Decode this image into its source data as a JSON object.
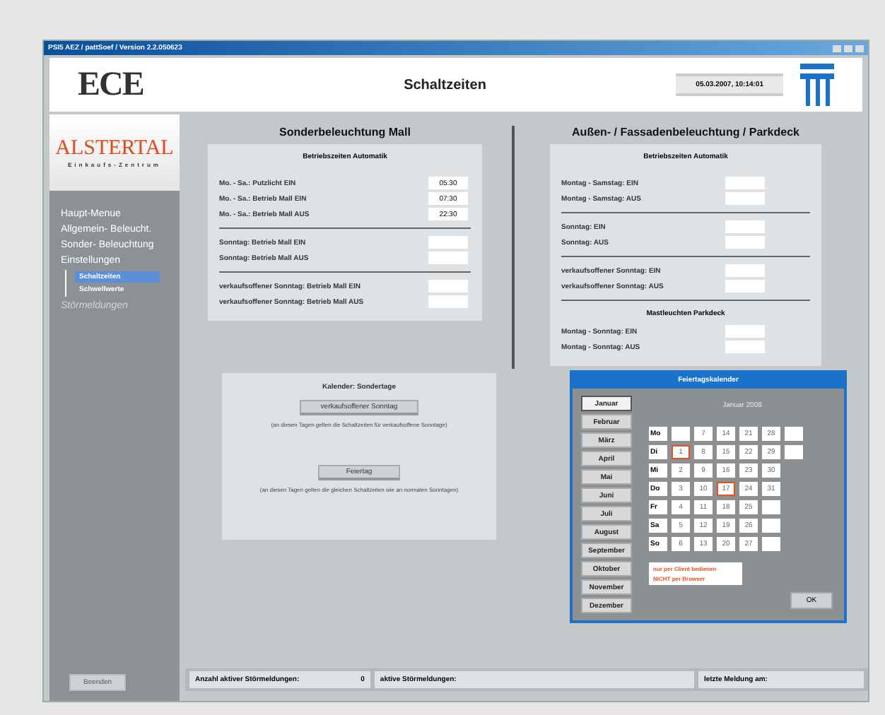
{
  "window": {
    "title": "PSI5 AEZ / pattSoef / Version 2.2.050623"
  },
  "header": {
    "logo": "ECE",
    "title": "Schaltzeiten",
    "datetime": "05.03.2007, 10:14:01"
  },
  "sidebar": {
    "logo": {
      "name": "ALSTERTAL",
      "tagline": "Einkaufs-Zentrum"
    },
    "items": [
      {
        "label": "Haupt-Menue",
        "disabled": false
      },
      {
        "label": "Allgemein- Beleucht.",
        "disabled": false
      },
      {
        "label": "Sonder- Beleuchtung",
        "disabled": false
      },
      {
        "label": "Einstellungen",
        "disabled": false,
        "children": [
          {
            "label": "Schaltzeiten",
            "selected": true
          },
          {
            "label": "Schwellwerte",
            "selected": false
          }
        ]
      },
      {
        "label": "Störmeldungen",
        "disabled": true
      }
    ],
    "exit_button": "Beenden"
  },
  "mall": {
    "title": "Sonderbeleuchtung Mall",
    "subtitle": "Betriebszeiten Automatik",
    "groups": [
      [
        {
          "label": "Mo. - Sa.: Putzlicht  EIN",
          "value": "05:30"
        },
        {
          "label": "Mo. - Sa.: Betrieb Mall  EIN",
          "value": "07:30"
        },
        {
          "label": "Mo. - Sa.: Betrieb Mall AUS",
          "value": "22:30"
        }
      ],
      [
        {
          "label": "Sonntag:  Betrieb Mall EIN"
        },
        {
          "label": "Sonntag:  Betrieb Mall AUS"
        }
      ],
      [
        {
          "label": "verkaufsoffener Sonntag:  Betrieb Mall EIN"
        },
        {
          "label": "verkaufsoffener Sonntag:  Betrieb Mall AUS"
        }
      ]
    ]
  },
  "outdoor": {
    "title": "Außen- / Fassadenbeleuchtung / Parkdeck",
    "subtitle": "Betriebszeiten Automatik",
    "groups": [
      [
        {
          "label": "Montag - Samstag:  EIN"
        },
        {
          "label": "Montag - Samstag:  AUS"
        }
      ],
      [
        {
          "label": "Sonntag:  EIN"
        },
        {
          "label": "Sonntag:  AUS"
        }
      ],
      [
        {
          "label": "verkaufsoffener Sonntag:  EIN"
        },
        {
          "label": "verkaufsoffener Sonntag:   AUS"
        }
      ]
    ],
    "parking_title": "Mastleuchten Parkdeck",
    "parking": [
      {
        "label": "Montag - Sonntag:  EIN"
      },
      {
        "label": "Montag - Sonntag:  AUS"
      }
    ]
  },
  "special_days": {
    "title": "Kalender: Sondertage",
    "items": [
      {
        "button": "verkaufsoffener Sonntag",
        "note": "(an diesen Tagen gelten die Schaltzeiten für verkaufsoffene Sonntage)"
      },
      {
        "button": "Feiertag",
        "note": "(an diesen Tagen gelten die gleichen Schaltzeiten wie an normalen Sonntagen)"
      }
    ]
  },
  "holiday_calendar": {
    "title": "Feiertagskalender",
    "months": [
      {
        "label": "Januar",
        "selected": true
      },
      {
        "label": "Februar",
        "selected": false
      },
      {
        "label": "März",
        "selected": false
      },
      {
        "label": "April",
        "selected": false
      },
      {
        "label": "Mai",
        "selected": false
      },
      {
        "label": "Juni",
        "selected": false
      },
      {
        "label": "Juli",
        "selected": false
      },
      {
        "label": "August",
        "selected": false
      },
      {
        "label": "September",
        "selected": false
      },
      {
        "label": "Oktober",
        "selected": false
      },
      {
        "label": "November",
        "selected": false
      },
      {
        "label": "Dezember",
        "selected": false
      }
    ],
    "month_title": "Januar 2008",
    "rows": [
      {
        "day": "Mo",
        "cells": [
          {
            "kind": "empty"
          },
          {
            "kind": "day",
            "text": "7",
            "selected": false
          },
          {
            "kind": "day",
            "text": "14",
            "selected": false
          },
          {
            "kind": "day",
            "text": "21",
            "selected": false
          },
          {
            "kind": "day",
            "text": "28",
            "selected": false
          },
          {
            "kind": "empty"
          }
        ]
      },
      {
        "day": "Di",
        "cells": [
          {
            "kind": "day",
            "text": "1",
            "selected": true
          },
          {
            "kind": "day",
            "text": "8",
            "selected": false
          },
          {
            "kind": "day",
            "text": "15",
            "selected": false
          },
          {
            "kind": "day",
            "text": "22",
            "selected": false
          },
          {
            "kind": "day",
            "text": "29",
            "selected": false
          },
          {
            "kind": "empty"
          }
        ]
      },
      {
        "day": "Mi",
        "cells": [
          {
            "kind": "day",
            "text": "2",
            "selected": false
          },
          {
            "kind": "day",
            "text": "9",
            "selected": false
          },
          {
            "kind": "day",
            "text": "16",
            "selected": false
          },
          {
            "kind": "day",
            "text": "23",
            "selected": false
          },
          {
            "kind": "day",
            "text": "30",
            "selected": false
          }
        ]
      },
      {
        "day": "Do",
        "cells": [
          {
            "kind": "day",
            "text": "3",
            "selected": false
          },
          {
            "kind": "day",
            "text": "10",
            "selected": false
          },
          {
            "kind": "day",
            "text": "17",
            "selected": true
          },
          {
            "kind": "day",
            "text": "24",
            "selected": false
          },
          {
            "kind": "day",
            "text": "31",
            "selected": false
          }
        ]
      },
      {
        "day": "Fr",
        "cells": [
          {
            "kind": "day",
            "text": "4",
            "selected": false
          },
          {
            "kind": "day",
            "text": "11",
            "selected": false
          },
          {
            "kind": "day",
            "text": "18",
            "selected": false
          },
          {
            "kind": "day",
            "text": "25",
            "selected": false
          },
          {
            "kind": "empty"
          }
        ]
      },
      {
        "day": "Sa",
        "cells": [
          {
            "kind": "day",
            "text": "5",
            "selected": false
          },
          {
            "kind": "day",
            "text": "12",
            "selected": false
          },
          {
            "kind": "day",
            "text": "19",
            "selected": false
          },
          {
            "kind": "day",
            "text": "26",
            "selected": false
          },
          {
            "kind": "empty"
          }
        ]
      },
      {
        "day": "So",
        "cells": [
          {
            "kind": "day",
            "text": "6",
            "selected": false
          },
          {
            "kind": "day",
            "text": "13",
            "selected": false
          },
          {
            "kind": "day",
            "text": "20",
            "selected": false
          },
          {
            "kind": "day",
            "text": "27",
            "selected": false
          },
          {
            "kind": "empty"
          }
        ]
      }
    ],
    "warning": [
      "nur per Client bedienen",
      "NICHT per Browser"
    ],
    "ok_button": "OK"
  },
  "status_bar": [
    {
      "label": "Anzahl aktiver Störmeldungen:",
      "value": "0"
    },
    {
      "label": "aktive Störmeldungen:"
    },
    {
      "label": "letzte Meldung am:"
    }
  ]
}
